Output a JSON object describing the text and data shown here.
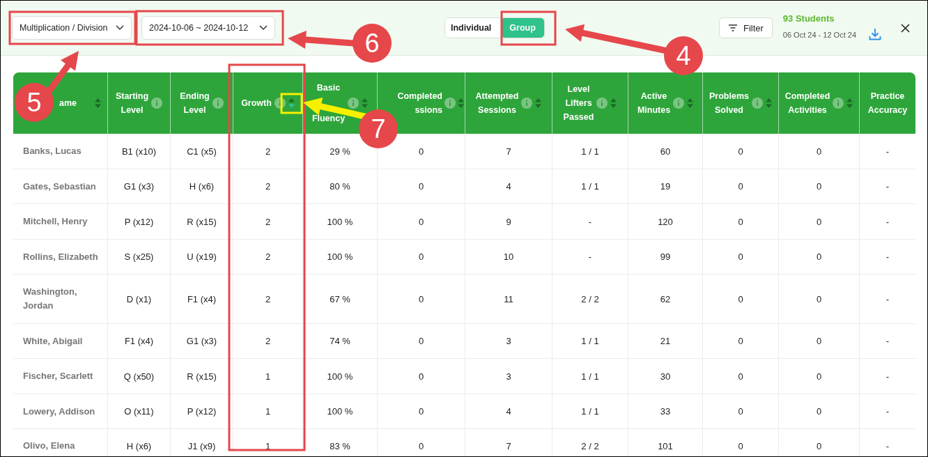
{
  "toolbar": {
    "operation_dropdown": "Multiplication / Division",
    "date_range_dropdown": "2024-10-06 ~ 2024-10-12",
    "view_tabs": [
      {
        "label": "Individual",
        "selected": false
      },
      {
        "label": "Group",
        "selected": true
      }
    ],
    "filter_button": "Filter",
    "student_count": "93 Students",
    "date_summary": "06 Oct 24 - 12 Oct 24"
  },
  "table": {
    "columns": [
      {
        "label": "ame",
        "info": false,
        "sortable": true,
        "sorted": false
      },
      {
        "label": "Starting Level",
        "info": true,
        "sortable": false
      },
      {
        "label": "Ending Level",
        "info": true,
        "sortable": false
      },
      {
        "label": "Growth",
        "info": true,
        "sortable": true,
        "sorted": true
      },
      {
        "label": "Basic Fluency",
        "info": true,
        "sortable": true,
        "sorted": false
      },
      {
        "label": "Completed ssions",
        "info": true,
        "sortable": true,
        "sorted": false
      },
      {
        "label": "Attempted Sessions",
        "info": true,
        "sortable": true,
        "sorted": false
      },
      {
        "label": "Level Lifters Passed",
        "info": true,
        "sortable": true,
        "sorted": false
      },
      {
        "label": "Active Minutes",
        "info": true,
        "sortable": true,
        "sorted": false
      },
      {
        "label": "Problems Solved",
        "info": true,
        "sortable": true,
        "sorted": false
      },
      {
        "label": "Completed Activities",
        "info": true,
        "sortable": true,
        "sorted": false
      },
      {
        "label": "Practice Accuracy",
        "info": false,
        "sortable": false
      }
    ],
    "rows": [
      [
        "Banks, Lucas",
        "B1 (x10)",
        "C1 (x5)",
        "2",
        "29 %",
        "0",
        "7",
        "1 / 1",
        "60",
        "0",
        "0",
        "-"
      ],
      [
        "Gates, Sebastian",
        "G1 (x3)",
        "H (x6)",
        "2",
        "80 %",
        "0",
        "4",
        "1 / 1",
        "19",
        "0",
        "0",
        "-"
      ],
      [
        "Mitchell, Henry",
        "P (x12)",
        "R (x15)",
        "2",
        "100 %",
        "0",
        "9",
        "-",
        "120",
        "0",
        "0",
        "-"
      ],
      [
        "Rollins, Elizabeth",
        "S (x25)",
        "U (x19)",
        "2",
        "100 %",
        "0",
        "10",
        "-",
        "99",
        "0",
        "0",
        "-"
      ],
      [
        "Washington, Jordan",
        "D (x1)",
        "F1 (x4)",
        "2",
        "67 %",
        "0",
        "11",
        "2 / 2",
        "62",
        "0",
        "0",
        "-"
      ],
      [
        "White, Abigail",
        "F1 (x4)",
        "G1 (x3)",
        "2",
        "74 %",
        "0",
        "3",
        "1 / 1",
        "21",
        "0",
        "0",
        "-"
      ],
      [
        "Fischer, Scarlett",
        "Q (x50)",
        "R (x15)",
        "1",
        "100 %",
        "0",
        "3",
        "1 / 1",
        "30",
        "0",
        "0",
        "-"
      ],
      [
        "Lowery, Addison",
        "O (x11)",
        "P (x12)",
        "1",
        "100 %",
        "0",
        "4",
        "1 / 1",
        "33",
        "0",
        "0",
        "-"
      ],
      [
        "Olivo, Elena",
        "H (x6)",
        "J1 (x9)",
        "1",
        "83 %",
        "0",
        "7",
        "2 / 2",
        "101",
        "0",
        "0",
        "-"
      ]
    ]
  },
  "annotations": [
    {
      "kind": "frame",
      "color": "#e5474b"
    },
    {
      "kind": "frame",
      "color": "#e5474b"
    },
    {
      "kind": "frame",
      "color": "#e5474b"
    },
    {
      "kind": "frame",
      "color": "#e5474b"
    },
    {
      "kind": "frame",
      "color": "#f5f100"
    },
    {
      "kind": "arrow",
      "color": "#e5474b"
    },
    {
      "kind": "arrow",
      "color": "#e5474b"
    },
    {
      "kind": "arrow",
      "color": "#e5474b"
    },
    {
      "kind": "arrow",
      "color": "#f5f100"
    },
    {
      "kind": "marker",
      "color": "#e5474b",
      "number": "5"
    },
    {
      "kind": "marker",
      "color": "#e5474b",
      "number": "6"
    },
    {
      "kind": "marker",
      "color": "#e5474b",
      "number": "4"
    },
    {
      "kind": "marker",
      "color": "#e5474b",
      "number": "7"
    }
  ]
}
